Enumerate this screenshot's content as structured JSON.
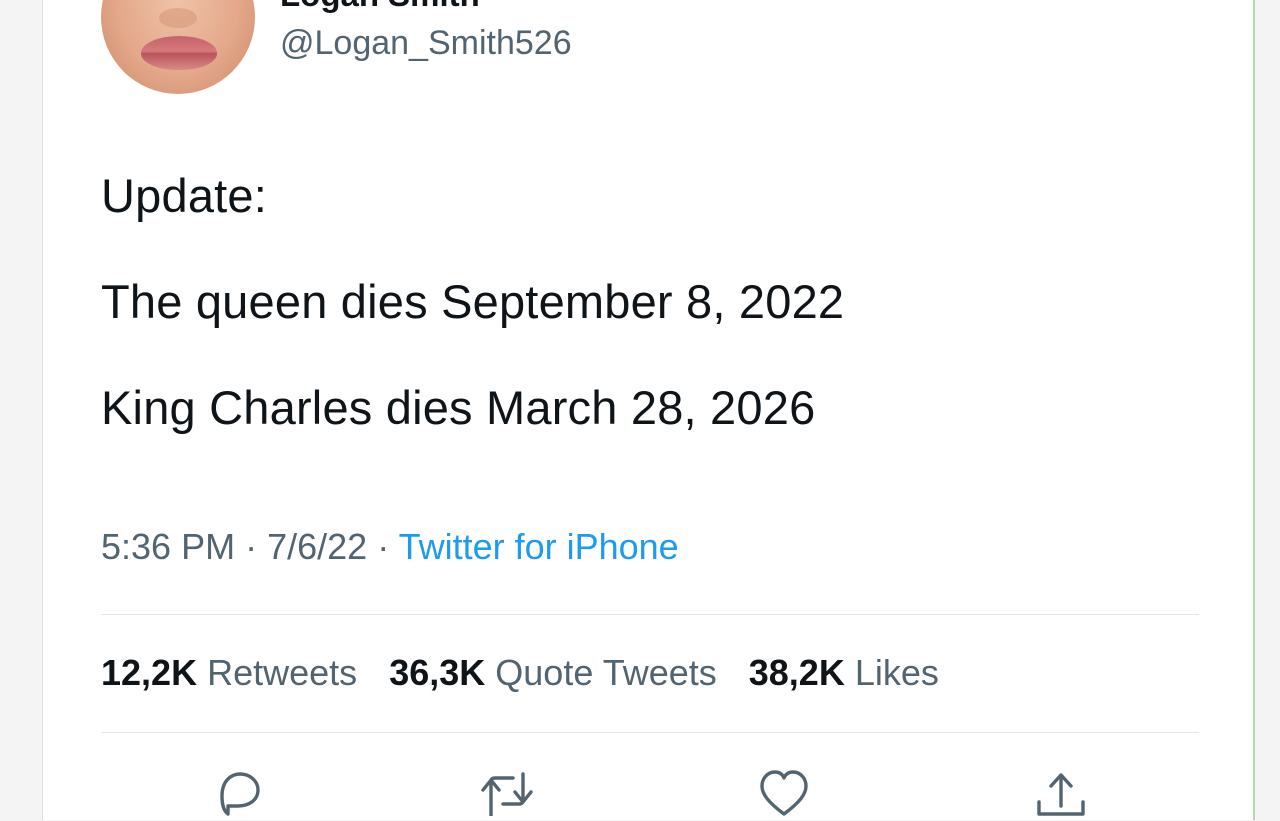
{
  "user": {
    "display_name": "Logan Smith",
    "handle": "@Logan_Smith526"
  },
  "tweet": {
    "lines": [
      "Update:",
      "The queen dies September 8, 2022",
      "King Charles dies March 28, 2026"
    ]
  },
  "meta": {
    "time": "5:36 PM",
    "date": "7/6/22",
    "separator": "·",
    "source": "Twitter for iPhone"
  },
  "stats": {
    "retweets_count": "12,2K",
    "retweets_label": "Retweets",
    "quotes_count": "36,3K",
    "quotes_label": "Quote Tweets",
    "likes_count": "38,2K",
    "likes_label": "Likes"
  },
  "actions": {
    "icons": [
      "reply-icon",
      "retweet-icon",
      "like-icon",
      "share-icon"
    ]
  },
  "colors": {
    "text": "#0f1419",
    "muted": "#536471",
    "link": "#1d9bf0"
  }
}
